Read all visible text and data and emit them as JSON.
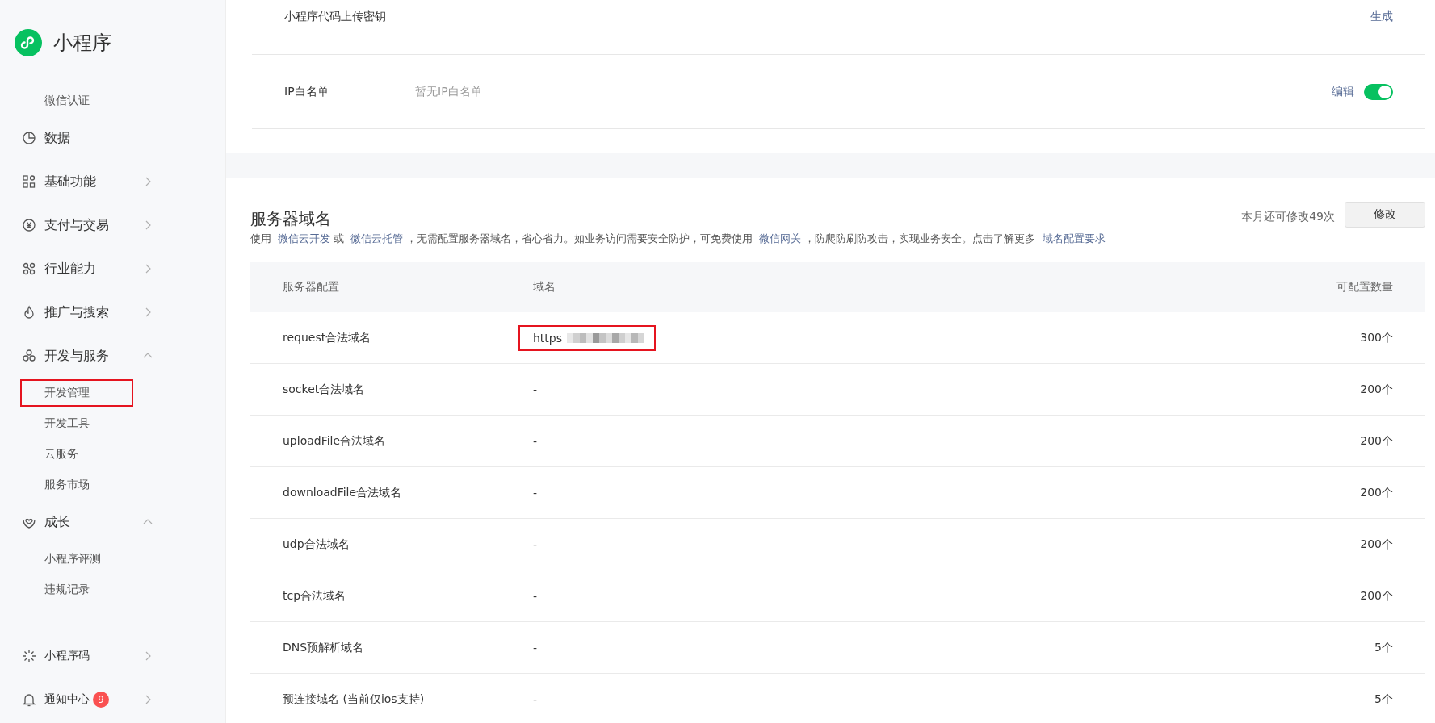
{
  "sidebar": {
    "brand": "小程序",
    "items": [
      {
        "kind": "sub",
        "label": "微信认证",
        "highlighted": false
      },
      {
        "kind": "group",
        "label": "数据"
      },
      {
        "kind": "group",
        "label": "基础功能",
        "expanded": false
      },
      {
        "kind": "group",
        "label": "支付与交易",
        "expanded": false
      },
      {
        "kind": "group",
        "label": "行业能力",
        "expanded": false
      },
      {
        "kind": "group",
        "label": "推广与搜索",
        "expanded": false
      },
      {
        "kind": "group",
        "label": "开发与服务",
        "expanded": true
      },
      {
        "kind": "sub",
        "label": "开发管理",
        "highlighted": true
      },
      {
        "kind": "sub",
        "label": "开发工具",
        "highlighted": false
      },
      {
        "kind": "sub",
        "label": "云服务",
        "highlighted": false
      },
      {
        "kind": "sub",
        "label": "服务市场",
        "highlighted": false
      },
      {
        "kind": "group",
        "label": "成长",
        "expanded": true
      },
      {
        "kind": "sub",
        "label": "小程序评测",
        "highlighted": false
      },
      {
        "kind": "sub",
        "label": "违规记录",
        "highlighted": false
      }
    ],
    "bottom": [
      {
        "label": "小程序码",
        "expanded": false
      },
      {
        "label": "通知中心",
        "badge": "9",
        "expanded": false
      }
    ]
  },
  "settings": {
    "rows": [
      {
        "label": "小程序代码上传密钥",
        "action": "生成"
      },
      {
        "label": "IP白名单",
        "value": "暂无IP白名单",
        "action": "编辑",
        "toggle": {
          "on": true
        }
      }
    ]
  },
  "server_domains": {
    "title": "服务器域名",
    "quota": "本月还可修改49次",
    "button": "修改",
    "description": [
      {
        "kind": "text",
        "text": "使用"
      },
      {
        "kind": "link",
        "text": "微信云开发"
      },
      {
        "kind": "text",
        "text": "或"
      },
      {
        "kind": "link",
        "text": "微信云托管"
      },
      {
        "kind": "text",
        "text": "，无需配置服务器域名，省心省力。如业务访问需要安全防护，可免费使用"
      },
      {
        "kind": "link",
        "text": "微信网关"
      },
      {
        "kind": "text",
        "text": "，防爬防刷防攻击，实现业务安全。点击了解更多"
      },
      {
        "kind": "link",
        "text": "域名配置要求"
      }
    ],
    "table": {
      "columns": [
        "服务器配置",
        "域名",
        "可配置数量"
      ],
      "rows": [
        {
          "config": "request合法域名",
          "domain": "https",
          "redacted": true,
          "highlighted": true,
          "count": "300个"
        },
        {
          "config": "socket合法域名",
          "domain": "-",
          "redacted": false,
          "highlighted": false,
          "count": "200个"
        },
        {
          "config": "uploadFile合法域名",
          "domain": "-",
          "redacted": false,
          "highlighted": false,
          "count": "200个"
        },
        {
          "config": "downloadFile合法域名",
          "domain": "-",
          "redacted": false,
          "highlighted": false,
          "count": "200个"
        },
        {
          "config": "udp合法域名",
          "domain": "-",
          "redacted": false,
          "highlighted": false,
          "count": "200个"
        },
        {
          "config": "tcp合法域名",
          "domain": "-",
          "redacted": false,
          "highlighted": false,
          "count": "200个"
        },
        {
          "config": "DNS预解析域名",
          "domain": "-",
          "redacted": false,
          "highlighted": false,
          "count": "5个"
        },
        {
          "config": "预连接域名 (当前仅ios支持)",
          "domain": "-",
          "redacted": false,
          "highlighted": false,
          "count": "5个"
        }
      ]
    }
  }
}
